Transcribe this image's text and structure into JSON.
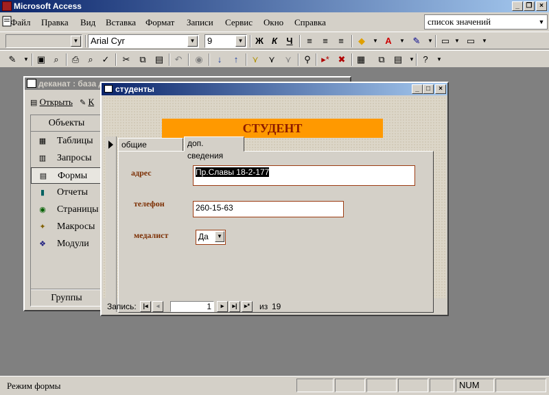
{
  "app": {
    "title": "Microsoft Access"
  },
  "menu": {
    "items": [
      "Файл",
      "Правка",
      "Вид",
      "Вставка",
      "Формат",
      "Записи",
      "Сервис",
      "Окно",
      "Справка"
    ],
    "help_search": "список значений"
  },
  "format_toolbar": {
    "object_select": "",
    "font": "Arial Cyr",
    "size": "9",
    "bold": "Ж",
    "italic": "К",
    "underline": "Ч"
  },
  "db_window": {
    "title": "деканат : база д",
    "open_label": "Открыть",
    "design_label": "К",
    "objects_header": "Объекты",
    "groups_label": "Группы",
    "objects": [
      {
        "label": "Таблицы",
        "icon": "table-icon"
      },
      {
        "label": "Запросы",
        "icon": "query-icon"
      },
      {
        "label": "Формы",
        "icon": "form-icon"
      },
      {
        "label": "Отчеты",
        "icon": "report-icon"
      },
      {
        "label": "Страницы",
        "icon": "page-icon"
      },
      {
        "label": "Макросы",
        "icon": "macro-icon"
      },
      {
        "label": "Модули",
        "icon": "module-icon"
      }
    ],
    "selected": "Формы"
  },
  "form": {
    "title": "студенты",
    "banner": "СТУДЕНТ",
    "tabs": [
      "общие сведения",
      "доп. сведения"
    ],
    "active_tab": "доп. сведения",
    "fields": {
      "address_label": "адрес",
      "address_value": "Пр.Славы 18-2-177",
      "phone_label": "телефон",
      "phone_value": "260-15-63",
      "medal_label": "медалист",
      "medal_value": "Да"
    },
    "nav": {
      "record_label": "Запись:",
      "current": "1",
      "of_label": "из",
      "total": "19"
    }
  },
  "status": {
    "mode": "Режим формы",
    "num": "NUM"
  }
}
